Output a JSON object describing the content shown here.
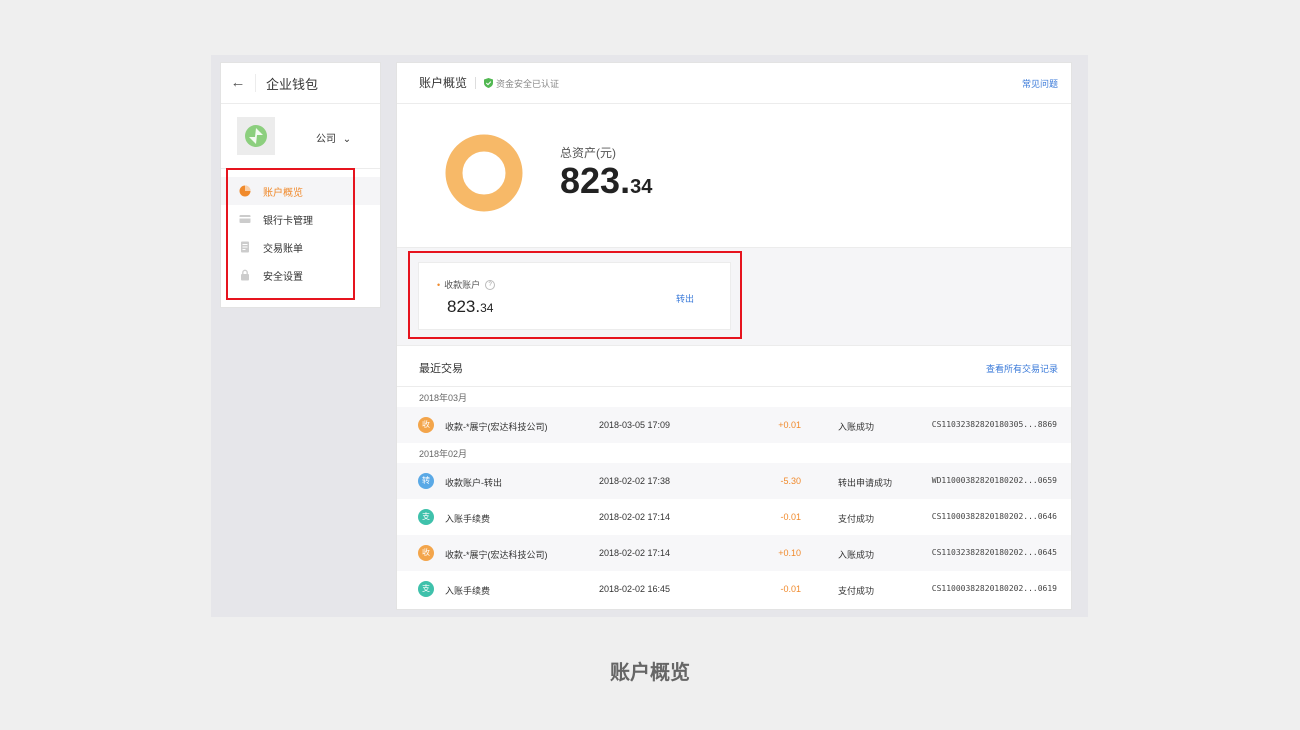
{
  "sidebar": {
    "back_icon": "arrow-left-icon",
    "title": "企业钱包",
    "company": "公司",
    "items": [
      {
        "label": "账户概览",
        "icon": "pie-chart-icon",
        "active": true
      },
      {
        "label": "银行卡管理",
        "icon": "card-icon",
        "active": false
      },
      {
        "label": "交易账单",
        "icon": "bill-icon",
        "active": false
      },
      {
        "label": "安全设置",
        "icon": "lock-icon",
        "active": false
      }
    ]
  },
  "header": {
    "title": "账户概览",
    "safe_text": "资金安全已认证",
    "help_link": "常见问题"
  },
  "asset": {
    "label": "总资产(元)",
    "value_int": "823.",
    "value_dec": "34"
  },
  "account": {
    "label": "收款账户",
    "value_int": "823.",
    "value_dec": "34",
    "action": "转出"
  },
  "recent": {
    "title": "最近交易",
    "view_all": "查看所有交易记录",
    "groups": [
      {
        "month": "2018年03月",
        "rows": [
          {
            "badge": "收",
            "name": "收款-*展宁(宏达科技公司)",
            "time": "2018-03-05 17:09",
            "amount": "+0.01",
            "status": "入账成功",
            "id": "CS11032382820180305...8869"
          }
        ]
      },
      {
        "month": "2018年02月",
        "rows": [
          {
            "badge": "转",
            "name": "收款账户-转出",
            "time": "2018-02-02 17:38",
            "amount": "-5.30",
            "status": "转出申请成功",
            "id": "WD11000382820180202...0659"
          },
          {
            "badge": "支",
            "name": "入账手续费",
            "time": "2018-02-02 17:14",
            "amount": "-0.01",
            "status": "支付成功",
            "id": "CS11000382820180202...0646"
          },
          {
            "badge": "收",
            "name": "收款-*展宁(宏达科技公司)",
            "time": "2018-02-02 17:14",
            "amount": "+0.10",
            "status": "入账成功",
            "id": "CS11032382820180202...0645"
          },
          {
            "badge": "支",
            "name": "入账手续费",
            "time": "2018-02-02 16:45",
            "amount": "-0.01",
            "status": "支付成功",
            "id": "CS11000382820180202...0619"
          }
        ]
      }
    ]
  },
  "caption": "账户概览",
  "colors": {
    "accent_orange": "#f08a2c",
    "donut": "#f7b968",
    "link_blue": "#3a7ad9",
    "highlight_red": "#e6141e",
    "badge_shou": "#f3a54b",
    "badge_zhuan": "#5aa9e6",
    "badge_zhi": "#3fc1ab"
  }
}
